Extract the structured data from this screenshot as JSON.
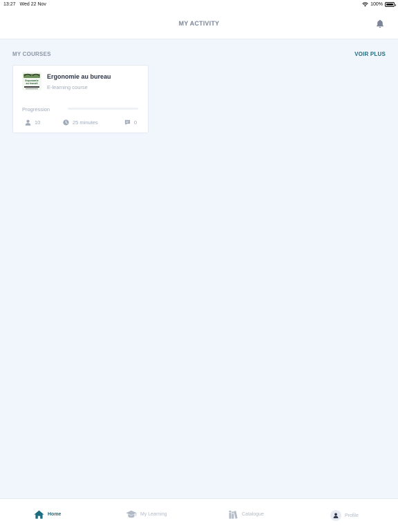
{
  "status_bar": {
    "time": "13:27",
    "date": "Wed 22 Nov",
    "battery": "100%"
  },
  "header": {
    "title": "MY ACTIVITY"
  },
  "courses_section": {
    "title": "MY COURSES",
    "see_more": "VOIR PLUS"
  },
  "course": {
    "title": "Ergonomie au bureau",
    "type": "E-learning course",
    "thumbnail_text": "Ergonomie au travail",
    "progress_label": "Progression",
    "progress": 0,
    "learners": "10",
    "duration": "25 minutes",
    "comments": "0"
  },
  "tab_bar": {
    "tabs": [
      {
        "label": "Home",
        "icon": "home-icon",
        "active": true
      },
      {
        "label": "My Learning",
        "icon": "graduation-cap-icon",
        "active": false
      },
      {
        "label": "Catalogue",
        "icon": "books-icon",
        "active": false
      },
      {
        "label": "Profile",
        "icon": "user-avatar-icon",
        "active": false
      }
    ]
  },
  "colors": {
    "accent": "#1e6c80",
    "background": "#f1f6fd",
    "muted_text": "#a0a9b8"
  }
}
